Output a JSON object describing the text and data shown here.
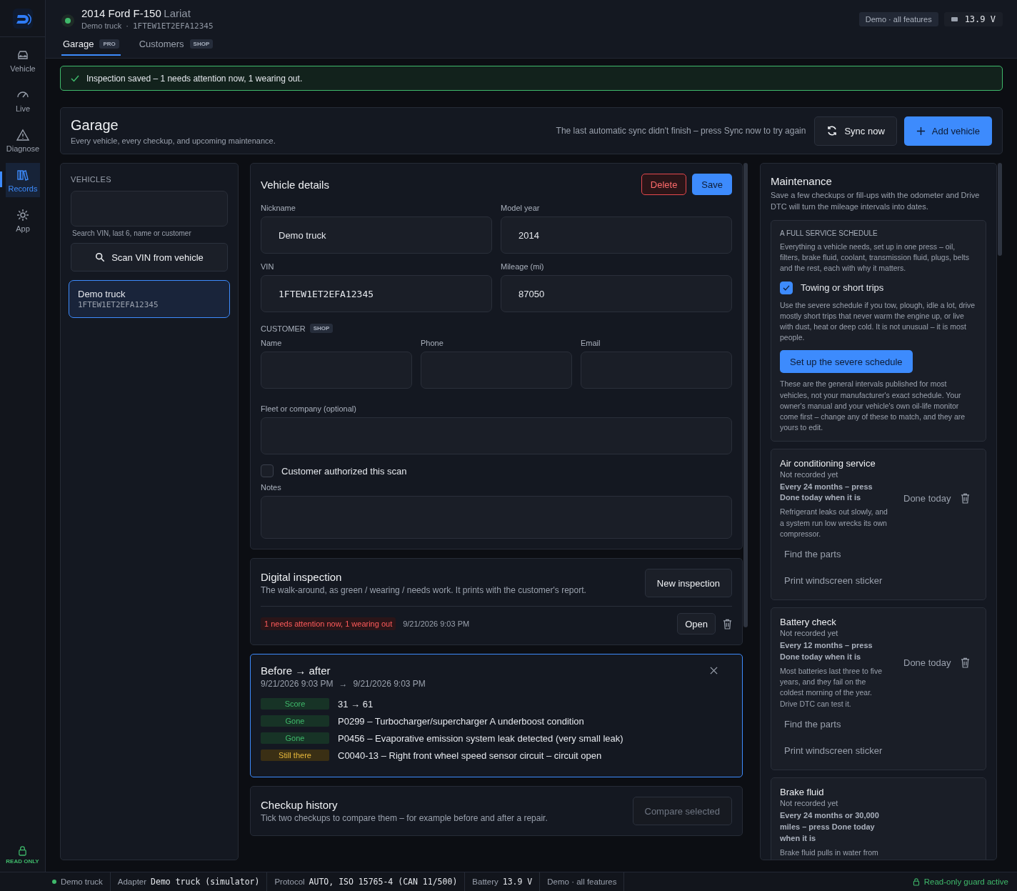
{
  "rail": {
    "items": [
      {
        "label": "Vehicle",
        "selected": false
      },
      {
        "label": "Live",
        "selected": false
      },
      {
        "label": "Diagnose",
        "selected": false
      },
      {
        "label": "Records",
        "selected": true
      },
      {
        "label": "App",
        "selected": false
      }
    ],
    "footer": "READ ONLY"
  },
  "header": {
    "title": "2014 Ford F-150",
    "trim": "Lariat",
    "nickname": "Demo truck",
    "separator": "·",
    "vin": "1FTEW1ET2EFA12345",
    "online": true,
    "mode_badge": "Demo · all features",
    "voltage": "13.9 V",
    "tabs": [
      {
        "label": "Garage",
        "badge": "PRO",
        "selected": true
      },
      {
        "label": "Customers",
        "badge": "SHOP",
        "selected": false
      }
    ]
  },
  "banner": {
    "text": "Inspection saved – 1 needs attention now, 1 wearing out."
  },
  "garage": {
    "title": "Garage",
    "subtitle": "Every vehicle, every checkup, and upcoming maintenance.",
    "sync_note": "The last automatic sync didn't finish – press Sync now to try again",
    "sync_button": "Sync now",
    "add_button": "Add vehicle"
  },
  "vehicles": {
    "heading": "VEHICLES",
    "search_hint": "Search VIN, last 6, name or customer",
    "scan_button": "Scan VIN from vehicle",
    "items": [
      {
        "name": "Demo truck",
        "vin": "1FTEW1ET2EFA12345",
        "selected": true
      }
    ]
  },
  "details": {
    "title": "Vehicle details",
    "delete_button": "Delete",
    "save_button": "Save",
    "fields": [
      {
        "label": "Nickname",
        "value": "Demo truck",
        "kind": "text"
      },
      {
        "label": "Model year",
        "value": "2014",
        "kind": "text"
      },
      {
        "label": "VIN",
        "value": "1FTEW1ET2EFA12345",
        "kind": "mono"
      },
      {
        "label": "Mileage (mi)",
        "value": "87050",
        "kind": "text"
      }
    ],
    "customer_heading": "CUSTOMER",
    "customer_badge": "SHOP",
    "customer_fields": [
      {
        "label": "Name"
      },
      {
        "label": "Phone"
      },
      {
        "label": "Email"
      }
    ],
    "fleet_label": "Fleet or company (optional)",
    "authorized": {
      "label": "Customer authorized this scan",
      "checked": false
    },
    "notes_label": "Notes"
  },
  "inspection": {
    "title": "Digital inspection",
    "subtitle": "The walk-around, as green / wearing / needs work. It prints with the customer's report.",
    "new_button": "New inspection",
    "entries": [
      {
        "summary": "1 needs attention now, 1 wearing out",
        "date": "9/21/2026 9:03 PM",
        "open_button": "Open"
      }
    ]
  },
  "compare": {
    "title": "Before → after",
    "from": "9/21/2026 9:03 PM",
    "arrow": "→",
    "to": "9/21/2026 9:03 PM",
    "rows": [
      {
        "status": "Score",
        "kind": "good",
        "text": "31 → 61"
      },
      {
        "status": "Gone",
        "kind": "good",
        "text": "P0299 – Turbocharger/supercharger A underboost condition"
      },
      {
        "status": "Gone",
        "kind": "good",
        "text": "P0456 – Evaporative emission system leak detected (very small leak)"
      },
      {
        "status": "Still there",
        "kind": "warn",
        "text": "C0040-13 – Right front wheel speed sensor circuit – circuit open"
      }
    ]
  },
  "history": {
    "title": "Checkup history",
    "subtitle": "Tick two checkups to compare them – for example before and after a repair.",
    "compare_button": "Compare selected",
    "compare_disabled": true
  },
  "maintenance": {
    "title": "Maintenance",
    "intro": "Save a few checkups or fill-ups with the odometer and Drive DTC will turn the mileage intervals into dates.",
    "schedule": {
      "heading": "A FULL SERVICE SCHEDULE",
      "text": "Everything a vehicle needs, set up in one press – oil, filters, brake fluid, coolant, transmission fluid, plugs, belts and the rest, each with why it matters.",
      "severe": {
        "label": "Towing or short trips",
        "checked": true
      },
      "severe_note": "Use the severe schedule if you tow, plough, idle a lot, drive mostly short trips that never warm the engine up, or live with dust, heat or deep cold. It is not unusual – it is most people.",
      "button": "Set up the severe schedule",
      "disclaimer": "These are the general intervals published for most vehicles, not your manufacturer's exact schedule. Your owner's manual and your vehicle's own oil-life monitor come first – change any of these to match, and they are yours to edit."
    },
    "items": [
      {
        "name": "Air conditioning service",
        "status": "Not recorded yet",
        "interval": "Every 24 months – press Done today when it is",
        "why": "Refrigerant leaks out slowly, and a system run low wrecks its own compressor.",
        "done_button": "Done today",
        "links": [
          "Find the parts",
          "Print windscreen sticker"
        ]
      },
      {
        "name": "Battery check",
        "status": "Not recorded yet",
        "interval": "Every 12 months – press Done today when it is",
        "why": "Most batteries last three to five years, and they fail on the coldest morning of the year. Drive DTC can test it.",
        "done_button": "Done today",
        "links": [
          "Find the parts",
          "Print windscreen sticker"
        ]
      },
      {
        "name": "Brake fluid",
        "status": "Not recorded yet",
        "interval": "Every 24 months or 30,000 miles – press Done today when it is",
        "why": "Brake fluid pulls in water from"
      }
    ]
  },
  "status_bar": {
    "vehicle": "Demo truck",
    "connected": true,
    "adapter_label": "Adapter",
    "adapter": "Demo truck (simulator)",
    "protocol_label": "Protocol",
    "protocol": "AUTO, ISO 15765-4 (CAN 11/500)",
    "battery_label": "Battery",
    "battery": "13.9 V",
    "mode": "Demo · all features",
    "guard": "Read-only guard active"
  }
}
